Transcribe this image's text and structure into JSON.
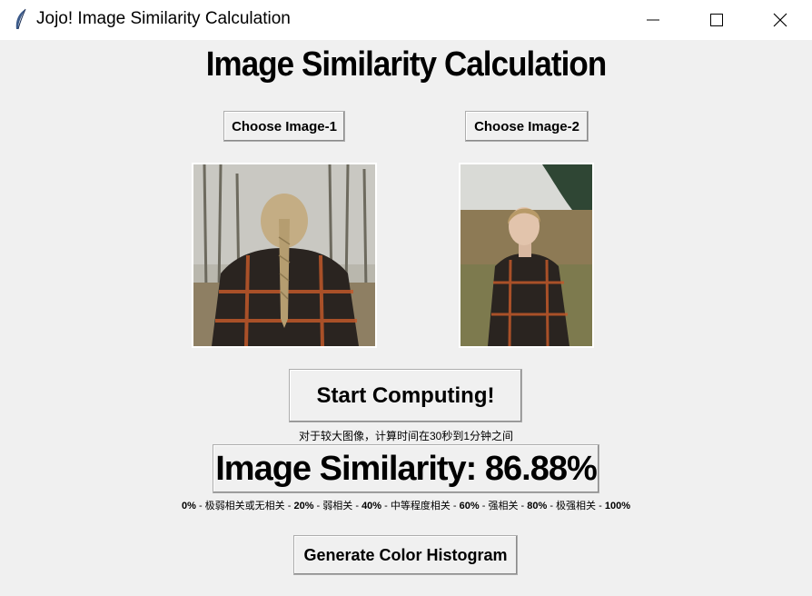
{
  "window": {
    "title": "Jojo! Image Similarity Calculation",
    "icon": "feather-icon",
    "controls": [
      "minimize-icon",
      "maximize-icon",
      "close-icon"
    ]
  },
  "main": {
    "heading": "Image Similarity Calculation",
    "choose1_label": "Choose Image-1",
    "choose2_label": "Choose Image-2",
    "start_label": "Start Computing!",
    "note": "对于较大图像，计算时间在30秒到1分钟之间",
    "result_label": "Image Similarity: 86.88%",
    "scale": {
      "p0": "0%",
      "s1": " - 极弱相关或无相关 - ",
      "p20": "20%",
      "s2": " - 弱相关 - ",
      "p40": "40%",
      "s3": " - 中等程度相关 - ",
      "p60": "60%",
      "s4": " - 强相关 - ",
      "p80": "80%",
      "s5": " - 极强相关 - ",
      "p100": "100%"
    },
    "histogram_label": "Generate Color Histogram"
  },
  "colors": {
    "background": "#f0f0f0",
    "titlebar": "#ffffff",
    "coat_dark": "#2a2420",
    "coat_plaid": "#c0582a"
  }
}
